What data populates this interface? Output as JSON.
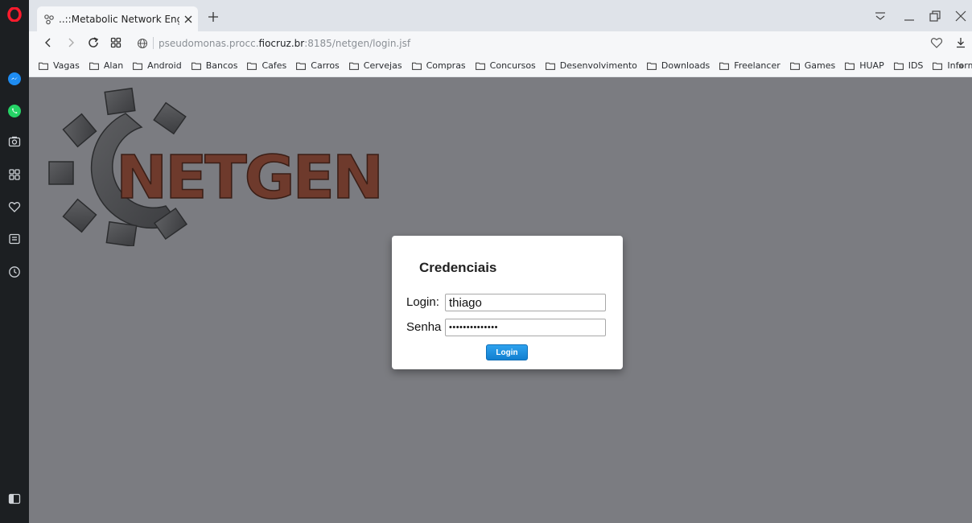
{
  "tab": {
    "title": "..::Metabolic Network Engi",
    "icon": "molecule-icon"
  },
  "address_bar": {
    "host_prefix": "pseudomonas.procc.",
    "host": "fiocruz.br",
    "path": ":8185/netgen/login.jsf"
  },
  "bookmarks": [
    "Vagas",
    "Alan",
    "Android",
    "Bancos",
    "Cafes",
    "Carros",
    "Cervejas",
    "Compras",
    "Concursos",
    "Desenvolvimento",
    "Downloads",
    "Freelancer",
    "Games",
    "HUAP",
    "IDS",
    "Informativos"
  ],
  "bookmarks_more": "»",
  "logo": {
    "text": "NETGEN"
  },
  "login_form": {
    "title": "Credenciais",
    "login_label": "Login:",
    "login_value": "thiago",
    "password_label": "Senha",
    "password_value": "••••••••••••••",
    "button_label": "Login"
  },
  "colors": {
    "page_bg": "#7b7c81",
    "logo_red": "#6e3a2c",
    "button_blue": "#1a8ee0",
    "sidebar": "#1c1f22"
  }
}
